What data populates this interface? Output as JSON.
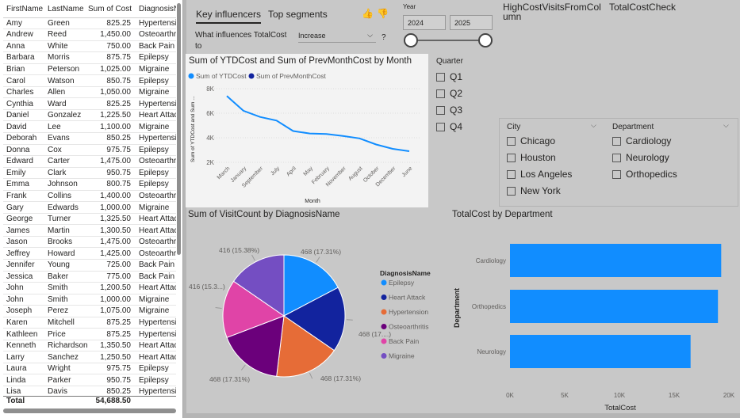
{
  "table": {
    "headers": [
      "FirstName",
      "LastName",
      "Sum of Cost",
      "DiagnosisN"
    ],
    "rows": [
      [
        "Amy",
        "Green",
        "825.25",
        "Hypertensi"
      ],
      [
        "Andrew",
        "Reed",
        "1,450.00",
        "Osteoarthr"
      ],
      [
        "Anna",
        "White",
        "750.00",
        "Back Pain"
      ],
      [
        "Barbara",
        "Morris",
        "875.75",
        "Epilepsy"
      ],
      [
        "Brian",
        "Peterson",
        "1,025.00",
        "Migraine"
      ],
      [
        "Carol",
        "Watson",
        "850.75",
        "Epilepsy"
      ],
      [
        "Charles",
        "Allen",
        "1,050.00",
        "Migraine"
      ],
      [
        "Cynthia",
        "Ward",
        "825.25",
        "Hypertensi"
      ],
      [
        "Daniel",
        "Gonzalez",
        "1,225.50",
        "Heart Attac"
      ],
      [
        "David",
        "Lee",
        "1,100.00",
        "Migraine"
      ],
      [
        "Deborah",
        "Evans",
        "850.25",
        "Hypertensi"
      ],
      [
        "Donna",
        "Cox",
        "975.75",
        "Epilepsy"
      ],
      [
        "Edward",
        "Carter",
        "1,475.00",
        "Osteoarthr"
      ],
      [
        "Emily",
        "Clark",
        "950.75",
        "Epilepsy"
      ],
      [
        "Emma",
        "Johnson",
        "800.75",
        "Epilepsy"
      ],
      [
        "Frank",
        "Collins",
        "1,400.00",
        "Osteoarthr"
      ],
      [
        "Gary",
        "Edwards",
        "1,000.00",
        "Migraine"
      ],
      [
        "George",
        "Turner",
        "1,325.50",
        "Heart Attac"
      ],
      [
        "James",
        "Martin",
        "1,300.50",
        "Heart Attac"
      ],
      [
        "Jason",
        "Brooks",
        "1,475.00",
        "Osteoarthr"
      ],
      [
        "Jeffrey",
        "Howard",
        "1,425.00",
        "Osteoarthr"
      ],
      [
        "Jennifer",
        "Young",
        "725.00",
        "Back Pain"
      ],
      [
        "Jessica",
        "Baker",
        "775.00",
        "Back Pain"
      ],
      [
        "John",
        "Smith",
        "1,200.50",
        "Heart Attac"
      ],
      [
        "John",
        "Smith",
        "1,000.00",
        "Migraine"
      ],
      [
        "Joseph",
        "Perez",
        "1,075.00",
        "Migraine"
      ],
      [
        "Karen",
        "Mitchell",
        "875.25",
        "Hypertensi"
      ],
      [
        "Kathleen",
        "Price",
        "875.25",
        "Hypertensi"
      ],
      [
        "Kenneth",
        "Richardson",
        "1,350.50",
        "Heart Attac"
      ],
      [
        "Larry",
        "Sanchez",
        "1,250.50",
        "Heart Attac"
      ],
      [
        "Laura",
        "Wright",
        "975.75",
        "Epilepsy"
      ],
      [
        "Linda",
        "Parker",
        "950.75",
        "Epilepsy"
      ],
      [
        "Lisa",
        "Davis",
        "850.25",
        "Hypertensi"
      ]
    ],
    "total_label": "Total",
    "total_value": "54,688.50"
  },
  "key_influencers": {
    "tab_key": "Key influencers",
    "tab_segments": "Top segments",
    "question": "What influences TotalCost to",
    "dropdown_value": "Increase",
    "help": "?",
    "thumbs_up": "👍",
    "thumbs_down": "👎"
  },
  "year_slicer": {
    "label": "Year",
    "start": "2024",
    "end": "2025"
  },
  "cards": {
    "high_cost": "HighCostVisitsFromCol umn",
    "total_cost_check": "TotalCostCheck"
  },
  "quarter_slicer": {
    "label": "Quarter",
    "items": [
      "Q1",
      "Q2",
      "Q3",
      "Q4"
    ]
  },
  "city_slicer": {
    "label": "City",
    "items": [
      "Chicago",
      "Houston",
      "Los Angeles",
      "New York"
    ]
  },
  "department_slicer": {
    "label": "Department",
    "items": [
      "Cardiology",
      "Neurology",
      "Orthopedics"
    ]
  },
  "line_chart": {
    "title": "Sum of YTDCost and Sum of PrevMonthCost by Month",
    "legend": [
      "Sum of YTDCost",
      "Sum of PrevMonthCost"
    ],
    "xlabel": "Month",
    "ylabel": "Sum of YTDCost and Sum ...",
    "yticks": [
      "8K",
      "6K",
      "4K",
      "2K"
    ],
    "months": [
      "March",
      "January",
      "September",
      "July",
      "April",
      "May",
      "February",
      "November",
      "August",
      "October",
      "December",
      "June"
    ],
    "values": [
      7400,
      6200,
      5700,
      5400,
      4550,
      4350,
      4300,
      4150,
      3950,
      3450,
      3100,
      2900
    ],
    "ylim": [
      2000,
      8000
    ],
    "color_ytd": "#118dff",
    "color_prev": "#12239e"
  },
  "pie_chart": {
    "title": "Sum of VisitCount by DiagnosisName",
    "legend_title": "DiagnosisName",
    "slices": [
      {
        "name": "Epilepsy",
        "value": 468,
        "label": "468 (17.31%)",
        "color": "#118dff"
      },
      {
        "name": "Heart Attack",
        "value": 468,
        "label": "468 (17....)",
        "color": "#12239e"
      },
      {
        "name": "Hypertension",
        "value": 468,
        "label": "468 (17.31%)",
        "color": "#e66c37"
      },
      {
        "name": "Osteoarthritis",
        "value": 468,
        "label": "468 (17.31%)",
        "color": "#6b007b"
      },
      {
        "name": "Back Pain",
        "value": 416,
        "label": "416 (15.3...)",
        "color": "#e044a7"
      },
      {
        "name": "Migraine",
        "value": 416,
        "label": "416 (15.38%)",
        "color": "#744ec2"
      }
    ]
  },
  "chart_data": {
    "type": "bar",
    "title": "TotalCost by Department",
    "categories": [
      "Cardiology",
      "Orthopedics",
      "Neurology"
    ],
    "values": [
      19300,
      19000,
      16500
    ],
    "xlabel": "TotalCost",
    "ylabel": "Department",
    "xticks": [
      "0K",
      "5K",
      "10K",
      "15K",
      "20K"
    ],
    "xlim": [
      0,
      20000
    ],
    "color": "#118dff"
  }
}
